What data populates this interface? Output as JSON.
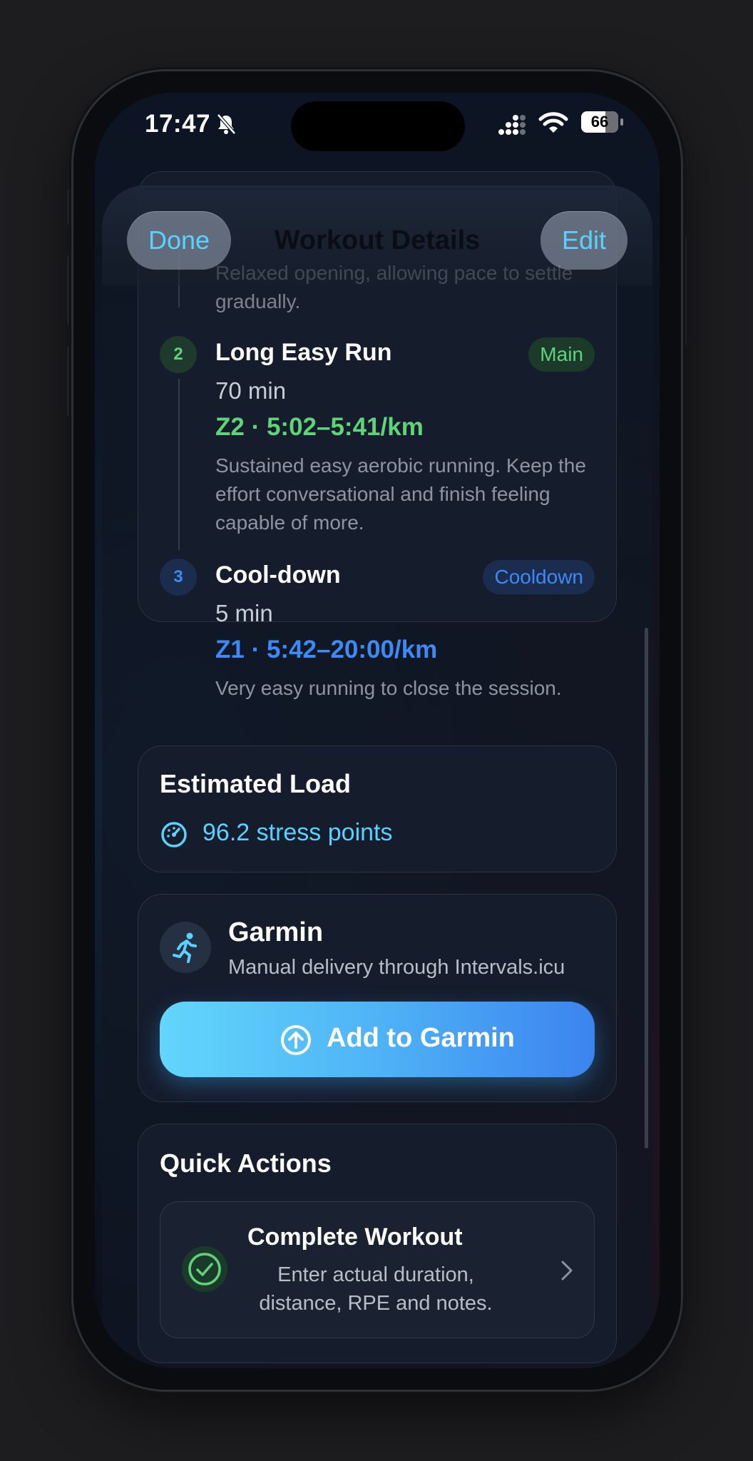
{
  "status_bar": {
    "time": "17:47",
    "battery": "66"
  },
  "nav": {
    "done": "Done",
    "title": "Workout Details",
    "edit": "Edit"
  },
  "steps": [
    {
      "partial_desc": "Relaxed opening, allowing pace to settle gradually."
    },
    {
      "number": "2",
      "title": "Long Easy Run",
      "badge": "Main",
      "duration": "70 min",
      "zone": "Z2 · 5:02–5:41/km",
      "desc_lines": [
        "Sustained easy aerobic running. Keep the",
        "effort conversational and finish feeling",
        "capable of more."
      ]
    },
    {
      "number": "3",
      "title": "Cool-down",
      "badge": "Cooldown",
      "duration": "5 min",
      "zone": "Z1 · 5:42–20:00/km",
      "desc_lines": [
        "Very easy running to close the session."
      ]
    }
  ],
  "load": {
    "title": "Estimated Load",
    "value": "96.2 stress points",
    "icon": "gauge-icon"
  },
  "garmin": {
    "title": "Garmin",
    "subtitle": "Manual delivery through Intervals.icu",
    "button": "Add to Garmin",
    "icon": "runner-icon"
  },
  "quick_actions": {
    "title": "Quick Actions",
    "complete": {
      "title": "Complete Workout",
      "desc_lines": [
        "Enter actual duration,",
        "distance, RPE and notes."
      ]
    }
  },
  "colors": {
    "accent_cyan": "#5ad2ff",
    "green": "#5fd37a",
    "blue": "#3d8af7"
  }
}
